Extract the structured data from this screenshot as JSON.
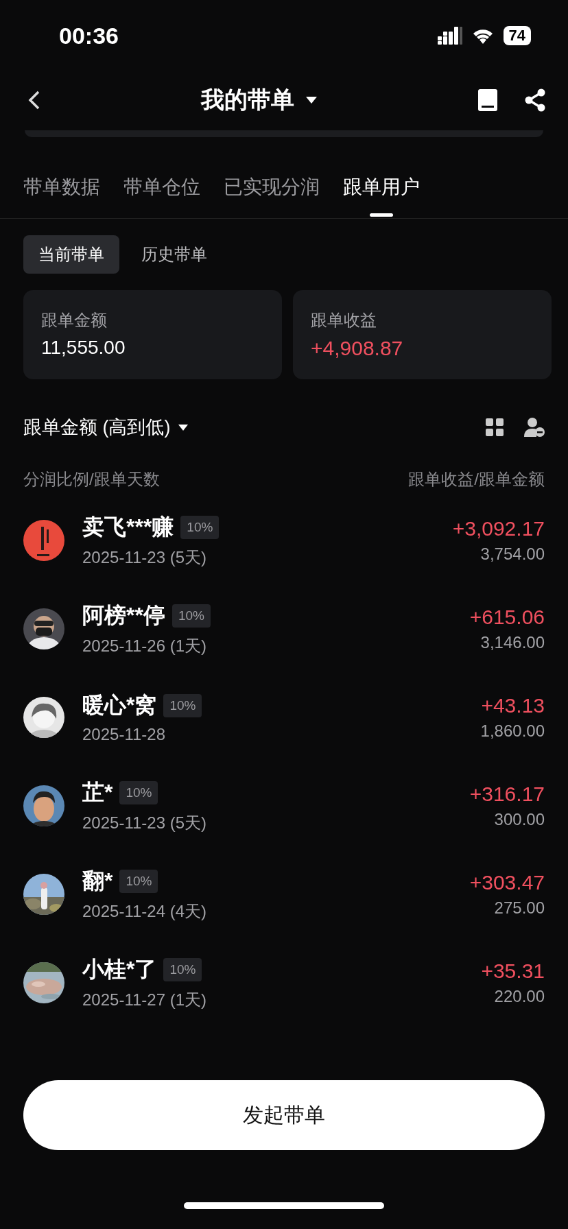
{
  "status_bar": {
    "time": "00:36",
    "battery": "74"
  },
  "header": {
    "title": "我的带单"
  },
  "tabs": [
    {
      "label": "带单数据",
      "selected": false
    },
    {
      "label": "带单仓位",
      "selected": false
    },
    {
      "label": "已实现分润",
      "selected": false
    },
    {
      "label": "跟单用户",
      "selected": true
    }
  ],
  "segments": [
    {
      "label": "当前带单",
      "selected": true
    },
    {
      "label": "历史带单",
      "selected": false
    }
  ],
  "summary": [
    {
      "label": "跟单金额",
      "value": "11,555.00",
      "kind": "plain"
    },
    {
      "label": "跟单收益",
      "value": "+4,908.87",
      "kind": "profit"
    }
  ],
  "sort": {
    "label": "跟单金额 (高到低)"
  },
  "list_header": {
    "left": "分润比例/跟单天数",
    "right": "跟单收益/跟单金额"
  },
  "followers": [
    {
      "name": "卖飞***赚",
      "share": "10%",
      "date": "2025-11-23 (5天)",
      "profit": "+3,092.17",
      "amount": "3,754.00"
    },
    {
      "name": "阿榜**停",
      "share": "10%",
      "date": "2025-11-26 (1天)",
      "profit": "+615.06",
      "amount": "3,146.00"
    },
    {
      "name": "暖心*窝",
      "share": "10%",
      "date": "2025-11-28",
      "profit": "+43.13",
      "amount": "1,860.00"
    },
    {
      "name": "芷*",
      "share": "10%",
      "date": "2025-11-23 (5天)",
      "profit": "+316.17",
      "amount": "300.00"
    },
    {
      "name": "翻*",
      "share": "10%",
      "date": "2025-11-24 (4天)",
      "profit": "+303.47",
      "amount": "275.00"
    },
    {
      "name": "小桂*了",
      "share": "10%",
      "date": "2025-11-27 (1天)",
      "profit": "+35.31",
      "amount": "220.00"
    }
  ],
  "action_button": "发起带单"
}
